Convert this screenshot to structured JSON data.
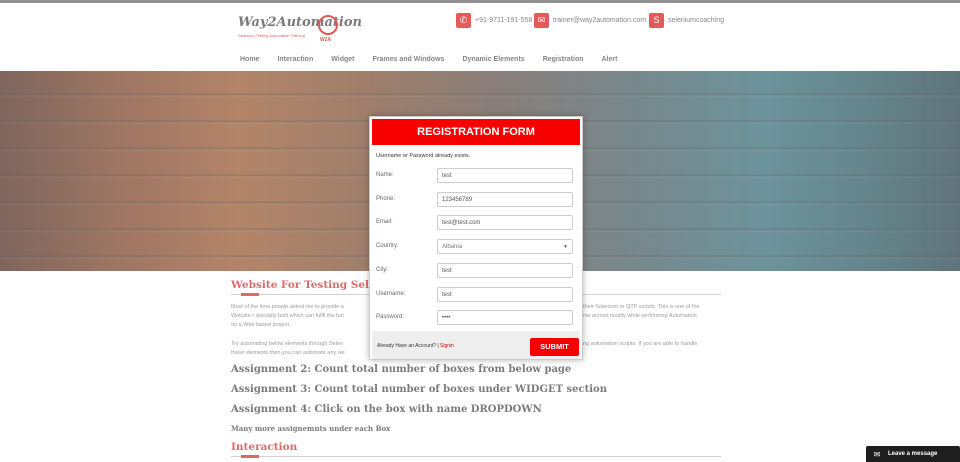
{
  "header": {
    "logo_name": "Way2Automation",
    "logo_tagline": "Selenium  Testing  Automation  Training",
    "logo_mark": "W2A",
    "contacts": [
      {
        "icon": "phone-icon",
        "text": "+91-9711-191-558"
      },
      {
        "icon": "mail-icon",
        "text": "trainer@way2automation.com"
      },
      {
        "icon": "skype-icon",
        "text": "seleniumcoaching"
      }
    ],
    "nav": [
      "Home",
      "Interaction",
      "Widget",
      "Frames and Windows",
      "Dynamic Elements",
      "Registration",
      "Alert"
    ]
  },
  "page": {
    "section_title": "Website For Testing Seleni",
    "para1": "Most of the time people asked me to provide a",
    "para1_right": "their Selenium or QTP scripts. This is one of the",
    "para1_line2": "Website I specially built which can fulfil the fun",
    "para1_line2_right": "me across mostly while performing Automation",
    "para1_line3": "on a Web based project .",
    "para2": "Try automating below elements through Selen",
    "para2_right": "ng automation scripts. If you are able to handle",
    "para2_line2": "these elements then you can automate any we",
    "assignment2": "Assignment 2: Count total number of boxes from below page",
    "assignment3": "Assignment 3: Count total number of boxes under WIDGET section",
    "assignment4": "Assignment 4: Click on the box with name DROPDOWN",
    "more": "Many more assignemnts under each Box",
    "interaction_title": "Interaction"
  },
  "modal": {
    "title": "REGISTRATION FORM",
    "message": "Username or Password already exists.",
    "fields": {
      "name": {
        "label": "Name:",
        "value": "test"
      },
      "phone": {
        "label": "Phone:",
        "value": "123456789"
      },
      "email": {
        "label": "Email:",
        "value": "test@test.com"
      },
      "country": {
        "label": "Country:",
        "value": "Albania"
      },
      "city": {
        "label": "City:",
        "value": "test"
      },
      "username": {
        "label": "Username:",
        "value": "test"
      },
      "password": {
        "label": "Password:",
        "value": "••••"
      }
    },
    "footer_text": "Already Have an Account? | ",
    "signin": "Signin",
    "submit": "SUBMIT"
  },
  "chat": {
    "label": "Leave a message",
    "icon": "envelope-icon"
  },
  "colors": {
    "accent": "#f60000",
    "heading_red": "#c81c1c"
  }
}
